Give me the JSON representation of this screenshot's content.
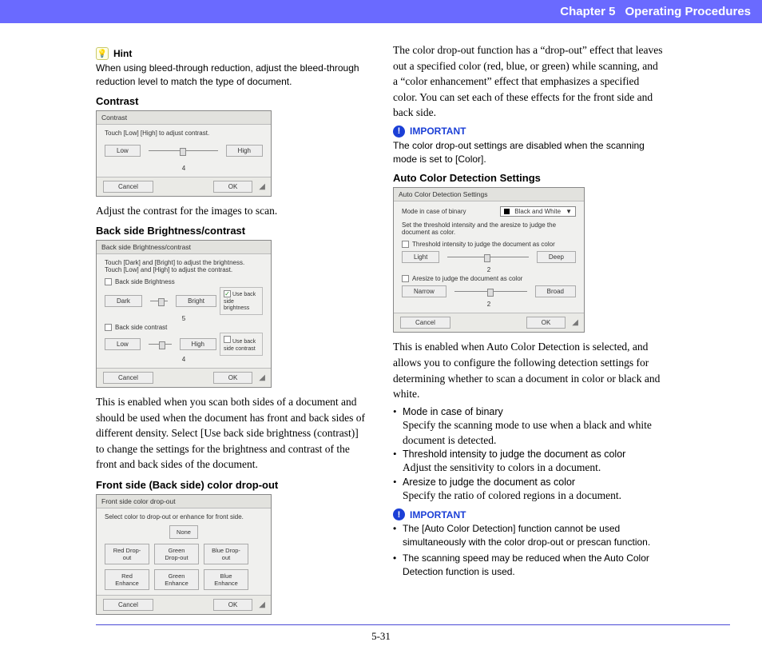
{
  "header": {
    "chapter": "Chapter 5",
    "title": "Operating Procedures"
  },
  "footer": {
    "page": "5-31"
  },
  "left": {
    "hint_label": "Hint",
    "hint_text": "When using bleed-through reduction, adjust the bleed-through reduction level to match the type of document.",
    "contrast": {
      "heading": "Contrast",
      "dlg_title": "Contrast",
      "instr": "Touch [Low] [High] to adjust contrast.",
      "low": "Low",
      "high": "High",
      "value": "4",
      "cancel": "Cancel",
      "ok": "OK",
      "caption": "Adjust the contrast for the images to scan."
    },
    "backside": {
      "heading": "Back side Brightness/contrast",
      "dlg_title": "Back side Brightness/contrast",
      "instr1": "Touch [Dark] and [Bright] to adjust the brightness.",
      "instr2": "Touch [Low] and [High] to adjust the contrast.",
      "row1_label": "Back side Brightness",
      "row1_chk": "Use back side brightness",
      "dark": "Dark",
      "bright": "Bright",
      "b_val": "5",
      "row2_label": "Back side contrast",
      "row2_chk": "Use back side contrast",
      "low": "Low",
      "high": "High",
      "c_val": "4",
      "cancel": "Cancel",
      "ok": "OK",
      "caption": "This is enabled when you scan both sides of a document and should be used when the document has front and back sides of different density. Select [Use back side brightness (contrast)] to change the settings for the brightness and contrast of the front and back sides of the document."
    },
    "dropout": {
      "heading": "Front side (Back side) color drop-out",
      "dlg_title": "Front side color drop-out",
      "instr": "Select color to drop-out or enhance for front side.",
      "none": "None",
      "opts": [
        "Red Drop-out",
        "Green Drop-out",
        "Blue Drop-out",
        "Red Enhance",
        "Green Enhance",
        "Blue Enhance"
      ],
      "cancel": "Cancel",
      "ok": "OK"
    }
  },
  "right": {
    "intro": "The color drop-out function has a “drop-out” effect that leaves out a specified color (red, blue, or green) while scanning, and a “color enhancement” effect that emphasizes a specified color. You can set each of these effects for the front side and back side.",
    "imp1_label": "IMPORTANT",
    "imp1_text": "The color drop-out settings are disabled when the scanning mode is set to [Color].",
    "acd": {
      "heading": "Auto Color Detection Settings",
      "dlg_title": "Auto Color Detection Settings",
      "mode_label": "Mode in case of binary",
      "mode_value": "Black and White",
      "sub": "Set the threshold intensity and the aresize to judge the document as color.",
      "thr_label": "Threshold intensity to judge the document as color",
      "light": "Light",
      "deep": "Deep",
      "thr_val": "2",
      "are_label": "Aresize to judge the document as color",
      "narrow": "Narrow",
      "broad": "Broad",
      "are_val": "2",
      "cancel": "Cancel",
      "ok": "OK",
      "caption": "This is enabled when Auto Color Detection is selected, and allows you to configure the following detection settings for determining whether to scan a document in color or black and white.",
      "bullets": [
        {
          "head": "Mode in case of binary",
          "body": "Specify the scanning mode to use when a black and white document is detected."
        },
        {
          "head": "Threshold intensity to judge the document as color",
          "body": "Adjust the sensitivity to colors in a document."
        },
        {
          "head": "Aresize to judge the document as color",
          "body": "Specify the ratio of colored regions in a document."
        }
      ]
    },
    "imp2_label": "IMPORTANT",
    "imp2_bullets": [
      "The [Auto Color Detection] function cannot be used simultaneously with the color drop-out or prescan function.",
      "The scanning speed may be reduced when the Auto Color Detection function is used."
    ]
  }
}
